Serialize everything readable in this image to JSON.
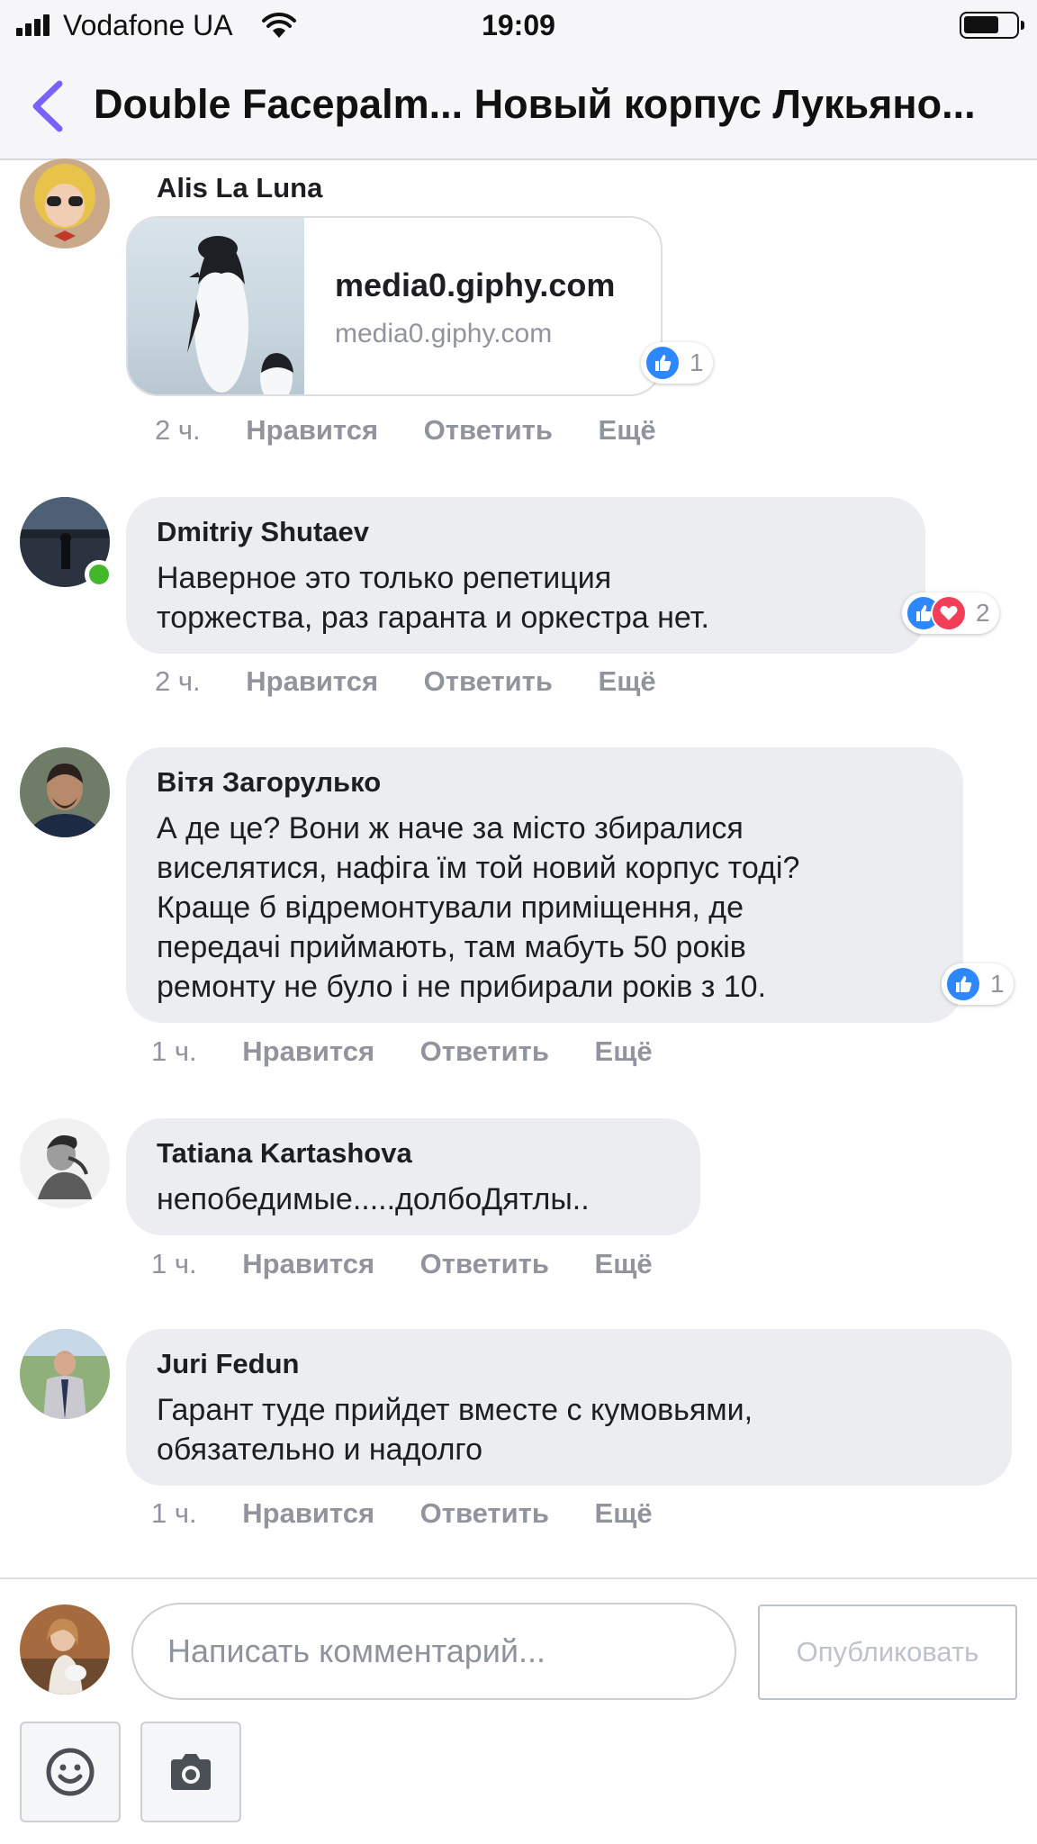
{
  "status_bar": {
    "carrier": "Vodafone UA",
    "time": "19:09"
  },
  "header": {
    "title": "Double Facepalm... Новый корпус Лукьяно..."
  },
  "actions": {
    "like": "Нравится",
    "reply": "Ответить",
    "more": "Ещё"
  },
  "comments": [
    {
      "author": "Alis La Luna",
      "time": "2 ч.",
      "link": {
        "title": "media0.giphy.com",
        "url": "media0.giphy.com"
      },
      "reaction_count": "1"
    },
    {
      "author": "Dmitriy Shutaev",
      "text": "Наверное это только репетиция\nторжества, раз гаранта и оркестра нет.",
      "time": "2 ч.",
      "reaction_count": "2"
    },
    {
      "author": "Вітя Загорулько",
      "text": "А де це? Вони ж наче за місто збиралися\nвиселятися, нафіга їм той новий корпус тоді?\nКраще б відремонтували приміщення, де\nпередачі приймають, там мабуть 50 років\nремонту не було і не прибирали років з 10.",
      "time": "1 ч.",
      "reaction_count": "1"
    },
    {
      "author": "Tatiana Kartashova",
      "text": "непобедимые.....долбоДятлы..",
      "time": "1 ч."
    },
    {
      "author": "Juri Fedun",
      "text": "Гарант туде прийдет вместе с кумовьями,\nобязательно и надолго",
      "time": "1 ч."
    }
  ],
  "composer": {
    "placeholder": "Написать комментарий...",
    "post_label": "Опубликовать"
  },
  "colors": {
    "accent": "#7b61ff",
    "like": "#2d88ff",
    "love": "#f33e58",
    "online": "#42b72a",
    "bubble": "#ebedf0"
  }
}
